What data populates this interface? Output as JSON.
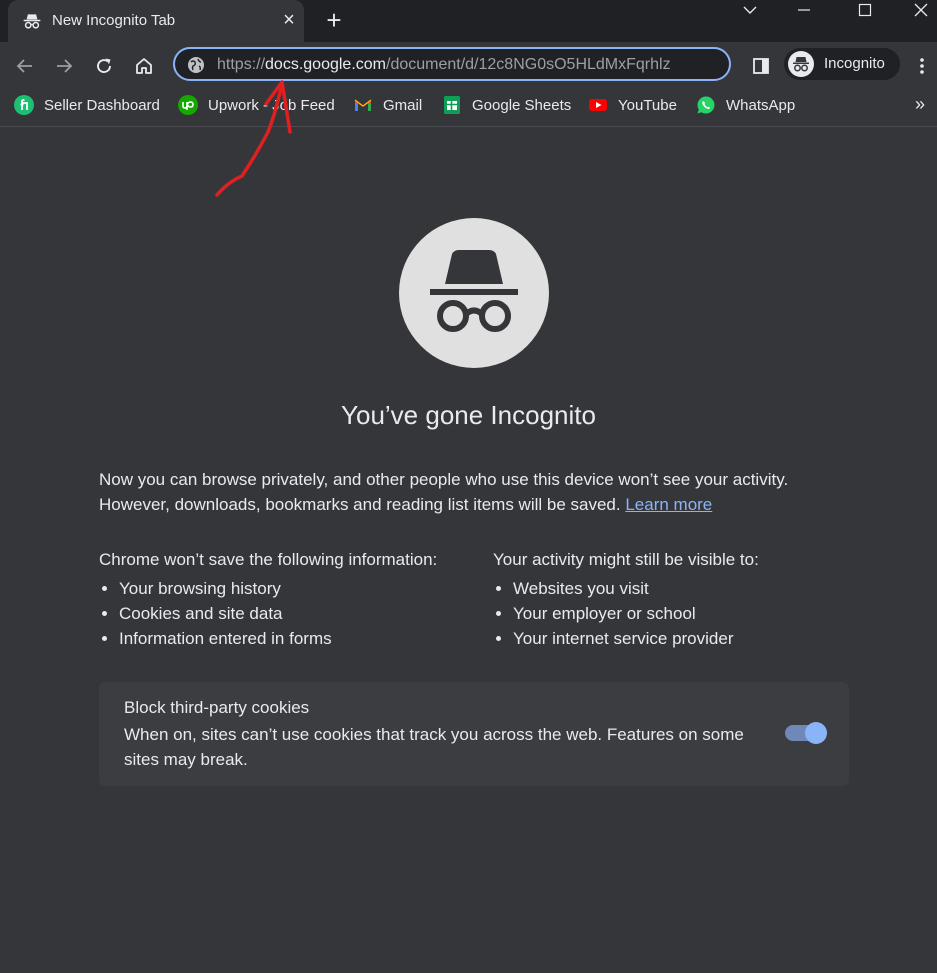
{
  "tab": {
    "title": "New Incognito Tab",
    "close_icon": "×",
    "new_tab_icon": "+"
  },
  "window_controls": [
    "chevron-down-icon",
    "minimize-icon",
    "maximize-icon",
    "close-icon"
  ],
  "omnibox": {
    "scheme": "https://",
    "host": "docs.google.com",
    "path": "/document/d/12c8NG0sO5HLdMxFqrhlz"
  },
  "profile": {
    "label": "Incognito"
  },
  "bookmarks": {
    "items": [
      {
        "label": "Seller Dashboard",
        "icon": "fiverr-icon"
      },
      {
        "label": "Upwork - Job Feed",
        "icon": "upwork-icon"
      },
      {
        "label": "Gmail",
        "icon": "gmail-icon"
      },
      {
        "label": "Google Sheets",
        "icon": "sheets-icon"
      },
      {
        "label": "YouTube",
        "icon": "youtube-icon"
      },
      {
        "label": "WhatsApp",
        "icon": "whatsapp-icon"
      }
    ],
    "overflow": "»"
  },
  "content": {
    "heading": "You’ve gone Incognito",
    "intro_text": "Now you can browse privately, and other people who use this device won’t see your activity. However, downloads, bookmarks and reading list items will be saved.",
    "learn_more": "Learn more",
    "left_heading": "Chrome won’t save the following information:",
    "left_items": [
      "Your browsing history",
      "Cookies and site data",
      "Information entered in forms"
    ],
    "right_heading": "Your activity might still be visible to:",
    "right_items": [
      "Websites you visit",
      "Your employer or school",
      "Your internet service provider"
    ]
  },
  "cookies": {
    "title": "Block third-party cookies",
    "description": "When on, sites can’t use cookies that track you across the web. Features on some sites may break.",
    "enabled": true
  },
  "colors": {
    "accent": "#8ab4f8",
    "background": "#35363a",
    "annotation": "#e02020"
  }
}
